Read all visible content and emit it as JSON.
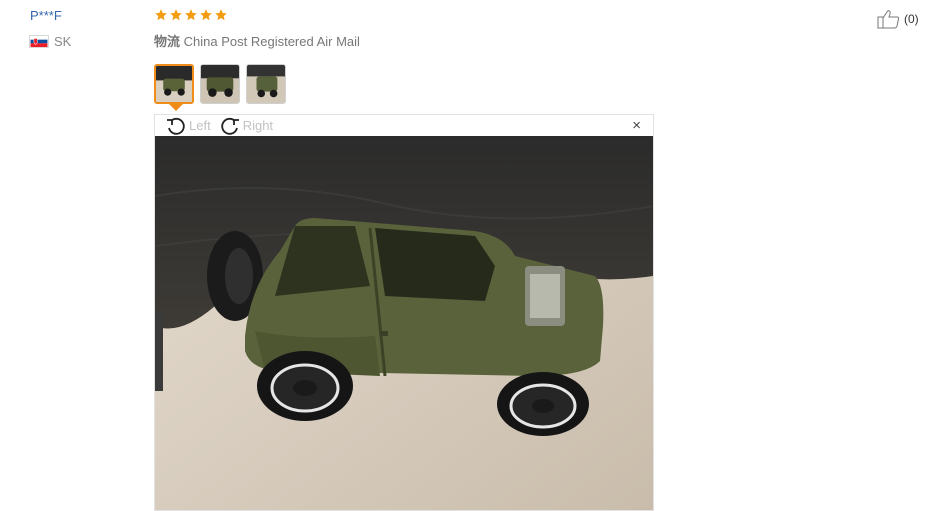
{
  "review": {
    "user": "P***F",
    "country": "SK",
    "rating": 5,
    "shipping_label": "物流",
    "shipping_method": "China Post Registered Air Mail",
    "helpful_count": "(0)"
  },
  "viewer": {
    "rotate_left_label": "Left",
    "rotate_right_label": "Right",
    "close_symbol": "×"
  },
  "thumbnails": [
    {
      "name": "photo-1",
      "active": true
    },
    {
      "name": "photo-2",
      "active": false
    },
    {
      "name": "photo-3",
      "active": false
    }
  ],
  "icons": {
    "flag": "slovakia-flag-icon",
    "star": "star-icon",
    "thumbs_up": "thumbs-up-icon",
    "rotate_left": "rotate-left-icon",
    "rotate_right": "rotate-right-icon"
  },
  "colors": {
    "user_link": "#3366aa",
    "star": "#f39c12",
    "active_thumb_border": "#f08c1a",
    "muted_text": "#777777"
  }
}
